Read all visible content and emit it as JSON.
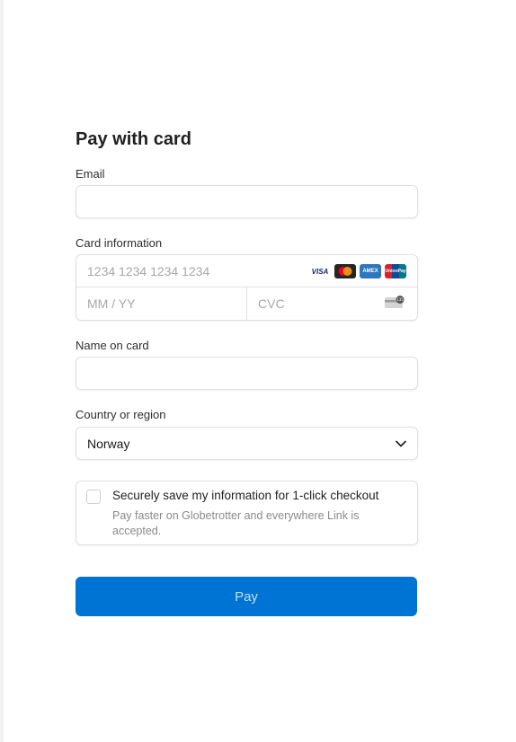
{
  "title": "Pay with card",
  "email": {
    "label": "Email",
    "value": ""
  },
  "card": {
    "label": "Card information",
    "number_placeholder": "1234 1234 1234 1234",
    "expiry_placeholder": "MM / YY",
    "cvc_placeholder": "CVC",
    "brands": [
      "VISA",
      "Mastercard",
      "American Express",
      "UnionPay"
    ],
    "brand_labels": {
      "visa": "VISA",
      "amex": "AMEX",
      "unionpay": "UnionPay"
    },
    "cvc_badge": "135"
  },
  "name": {
    "label": "Name on card",
    "value": ""
  },
  "country": {
    "label": "Country or region",
    "value": "Norway"
  },
  "link": {
    "title": "Securely save my information for 1-click checkout",
    "description": "Pay faster on Globetrotter and everywhere Link is accepted.",
    "checked": false
  },
  "pay_button": {
    "label": "Pay"
  },
  "colors": {
    "accent": "#0074d4",
    "pay_text": "#c9ddf3"
  }
}
